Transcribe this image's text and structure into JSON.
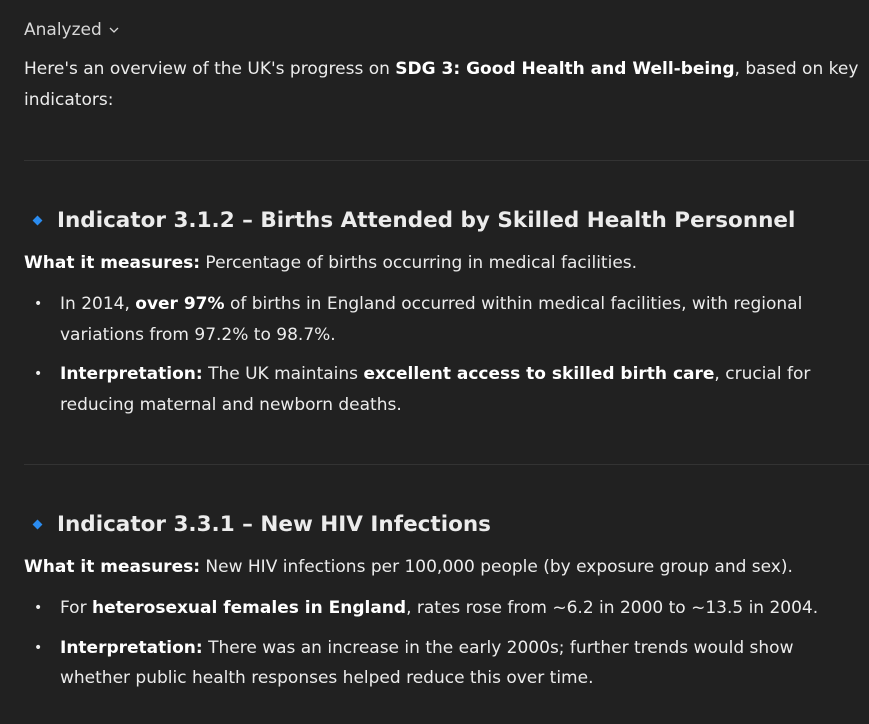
{
  "status": {
    "label": "Analyzed",
    "icon": "chevron-down-icon"
  },
  "intro": {
    "before": "Here's an overview of the UK's progress on ",
    "bold": "SDG 3: Good Health and Well-being",
    "after": ", based on key indicators:"
  },
  "accent": "#2b8cf0",
  "sections": [
    {
      "title": "Indicator 3.1.2 – Births Attended by Skilled Health Personnel",
      "measure_label": "What it measures:",
      "measure_text": " Percentage of births occurring in medical facilities.",
      "bullets": [
        {
          "a": "In 2014, ",
          "b": "over 97%",
          "c": " of births in England occurred within medical facilities, with regional variations from 97.2% to 98.7%."
        },
        {
          "a": "",
          "b": "Interpretation:",
          "c": " The UK maintains ",
          "d": "excellent access to skilled birth care",
          "e": ", crucial for reducing maternal and newborn deaths."
        }
      ]
    },
    {
      "title": "Indicator 3.3.1 – New HIV Infections",
      "measure_label": "What it measures:",
      "measure_text": " New HIV infections per 100,000 people (by exposure group and sex).",
      "bullets": [
        {
          "a": "For ",
          "b": "heterosexual females in England",
          "c": ", rates rose from ~6.2 in 2000 to ~13.5 in 2004."
        },
        {
          "a": "",
          "b": "Interpretation:",
          "c": " There was an increase in the early 2000s; further trends would show whether public health responses helped reduce this over time."
        }
      ]
    }
  ]
}
